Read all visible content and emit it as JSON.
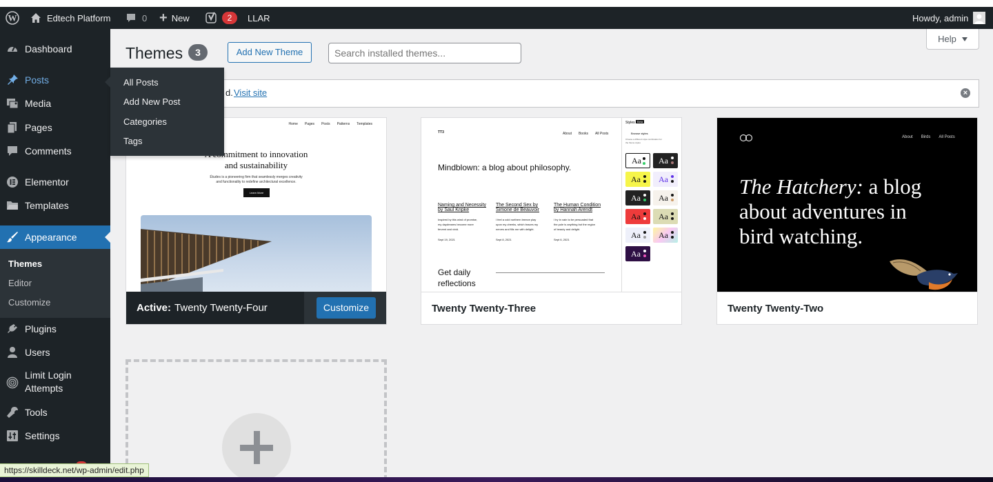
{
  "admin_bar": {
    "site_name": "Edtech Platform",
    "comments_count": "0",
    "new_label": "New",
    "yoast_count": "2",
    "llar_label": "LLAR",
    "howdy": "Howdy, admin"
  },
  "sidebar": {
    "dashboard": "Dashboard",
    "posts": "Posts",
    "media": "Media",
    "pages": "Pages",
    "comments": "Comments",
    "elementor": "Elementor",
    "templates": "Templates",
    "appearance": "Appearance",
    "appearance_sub": [
      "Themes",
      "Editor",
      "Customize"
    ],
    "plugins": "Plugins",
    "users": "Users",
    "limit_login_1": "Limit Login",
    "limit_login_2": "Attempts",
    "tools": "Tools",
    "settings": "Settings"
  },
  "posts_flyout": [
    "All Posts",
    "Add New Post",
    "Categories",
    "Tags"
  ],
  "page": {
    "title": "Themes",
    "count": "3",
    "add_new": "Add New Theme",
    "search_placeholder": "Search installed themes...",
    "help": "Help"
  },
  "notice": {
    "partial_text": "d.",
    "link": "Visit site"
  },
  "themes": {
    "active_prefix": "Active:",
    "active_name": "Twenty Twenty-Four",
    "customize": "Customize",
    "t2": "Twenty Twenty-Three",
    "t3": "Twenty Twenty-Two"
  },
  "preview_tt4": {
    "nav": [
      "Home",
      "Pages",
      "Posts",
      "Patterns",
      "Templates"
    ],
    "headline_1": "A commitment to innovation",
    "headline_2": "and sustainability",
    "body_1": "Études is a pioneering firm that seamlessly merges creativity",
    "body_2": "and functionality to redefine architectural excellence.",
    "btn": "Learn More"
  },
  "preview_tt3": {
    "logo": "TT3",
    "nav": [
      "About",
      "Books",
      "All Posts"
    ],
    "headline": "Mindblown: a blog about philosophy.",
    "posts": [
      {
        "t1": "Naming and Necessity",
        "t2": "by Saul Kripke",
        "b1": "Inspired by this wind of promise,",
        "b2": "my daydreams become more",
        "b3": "fervent and vivid.",
        "d": "Sept 19, 2021"
      },
      {
        "t1": "The Second Sex by",
        "t2": "Simone de Beauvoir",
        "b1": "I feel a cold northern breeze play",
        "b2": "upon my cheeks, which braces my",
        "b3": "nerves and fills me with delight.",
        "d": "Sept 8, 2021"
      },
      {
        "t1": "The Human Condition",
        "t2": "by Hannah Arendt",
        "b1": "I try in vain to be persuaded that",
        "b2": "the pole is anything but the region",
        "b3": "of beauty and delight.",
        "d": "Sept 6, 2021"
      }
    ],
    "get_daily_1": "Get daily",
    "get_daily_2": "reflections",
    "styles_label": "Styles",
    "styles_badge": "Beta",
    "browse": "Browse styles",
    "browse_desc_1": "Choose a different style combination for",
    "browse_desc_2": "the theme styles",
    "swatch": "Aa"
  },
  "preview_tt2": {
    "nav": [
      "About",
      "Birds",
      "All Posts"
    ],
    "line1_italic": "The Hatchery:",
    "line1_rest": " a blog",
    "line2": "about adventures in",
    "line3": "bird watching."
  },
  "status_url": "https://skilldeck.net/wp-admin/edit.php",
  "colors": {
    "admin_dark": "#1d2327",
    "wp_blue": "#2271b1",
    "sidebar_active": "#2271b1",
    "badge_red": "#d63638"
  }
}
